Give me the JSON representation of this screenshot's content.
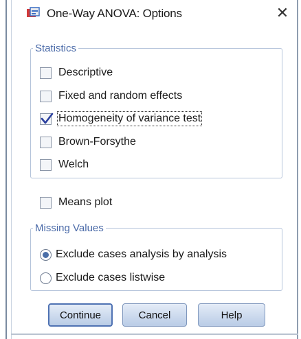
{
  "window": {
    "title": "One-Way ANOVA: Options",
    "app_icon": "spss-app-icon",
    "close_icon": "close-icon",
    "close_glyph": "✕"
  },
  "statistics": {
    "legend": "Statistics",
    "items": [
      {
        "label": "Descriptive",
        "checked": false
      },
      {
        "label": "Fixed and random effects",
        "checked": false
      },
      {
        "label": "Homogeneity of variance test",
        "checked": true
      },
      {
        "label": "Brown-Forsythe",
        "checked": false
      },
      {
        "label": "Welch",
        "checked": false
      }
    ]
  },
  "means_plot": {
    "label": "Means plot",
    "checked": false
  },
  "missing_values": {
    "legend": "Missing Values",
    "options": [
      {
        "label": "Exclude cases analysis by analysis",
        "selected": true
      },
      {
        "label": "Exclude cases listwise",
        "selected": false
      }
    ]
  },
  "buttons": {
    "continue": "Continue",
    "cancel": "Cancel",
    "help": "Help"
  },
  "colors": {
    "legend_text": "#4a6aa8",
    "check_mark": "#2a3f9e",
    "radio_dot": "#4b6fa8"
  }
}
